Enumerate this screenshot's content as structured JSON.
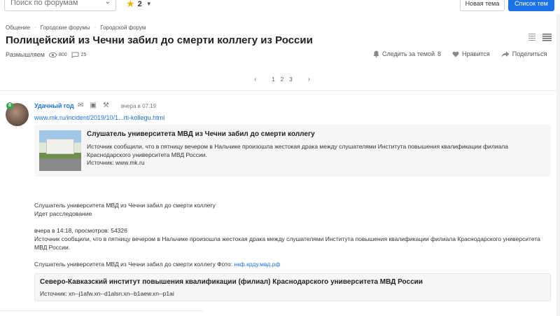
{
  "topbar": {
    "search_placeholder": "Поиск по форумам",
    "rating_value": "2",
    "new_topic_label": "Новая тема",
    "topics_list_label": "Список тем",
    "topics_button_color": "#1a73e8"
  },
  "breadcrumb": {
    "items": [
      "Общение",
      "Городские форумы",
      "Городской форум"
    ],
    "sep": "·"
  },
  "page_title": "Полицейский из Чечни забил до смерти коллегу из России",
  "meta": {
    "label": "Размышляем",
    "views": "800",
    "comments": "25"
  },
  "actions": {
    "follow_label": "Следить за темой",
    "follow_count": "8",
    "like_label": "Нравится",
    "share_label": "Поделиться"
  },
  "pager": {
    "pages": [
      "1",
      "2",
      "3"
    ],
    "prev": "‹",
    "next": "›"
  },
  "post": {
    "username": "Удачный год",
    "badge": "8",
    "time": "вчера в 07:19",
    "link": "www.mk.ru/incident/2019/10/1...rti-kollegu.html",
    "preview": {
      "title": "Слушатель университета МВД из Чечни забил до смерти коллегу",
      "description": "Источник сообщили, что в пятницу вечером в Нальчике произошла жестокая драка между слушателями Института повышения квалификации филиала Краснодарского университета МВД России.",
      "source": "Источник: www.mk.ru"
    },
    "body_line1": "Слушатель университета МВД из Чечни забил до смерти коллегу",
    "body_line2": "Идет расследование",
    "body_line3": "вчера в 14:18, просмотров: 54326",
    "body_line4": "Источник сообщили, что в пятницу вечером в Нальчике произошла жестокая драка между слушателями Института повышения квалификации филиала Краснодарского университета МВД России.",
    "body_line5_text": "Слушатель университета МВД из Чечни забил до смерти коллегу Фото:",
    "body_line5_link": "нкф.крду.мвд.рф",
    "site_card": {
      "title": "Северо-Кавказский институт повышения квалификации (филиал) Краснодарского университета МВД России",
      "source": "Источник: xn--j1afw.xn--d1alsn.xn--b1aew.xn--p1ai"
    }
  }
}
